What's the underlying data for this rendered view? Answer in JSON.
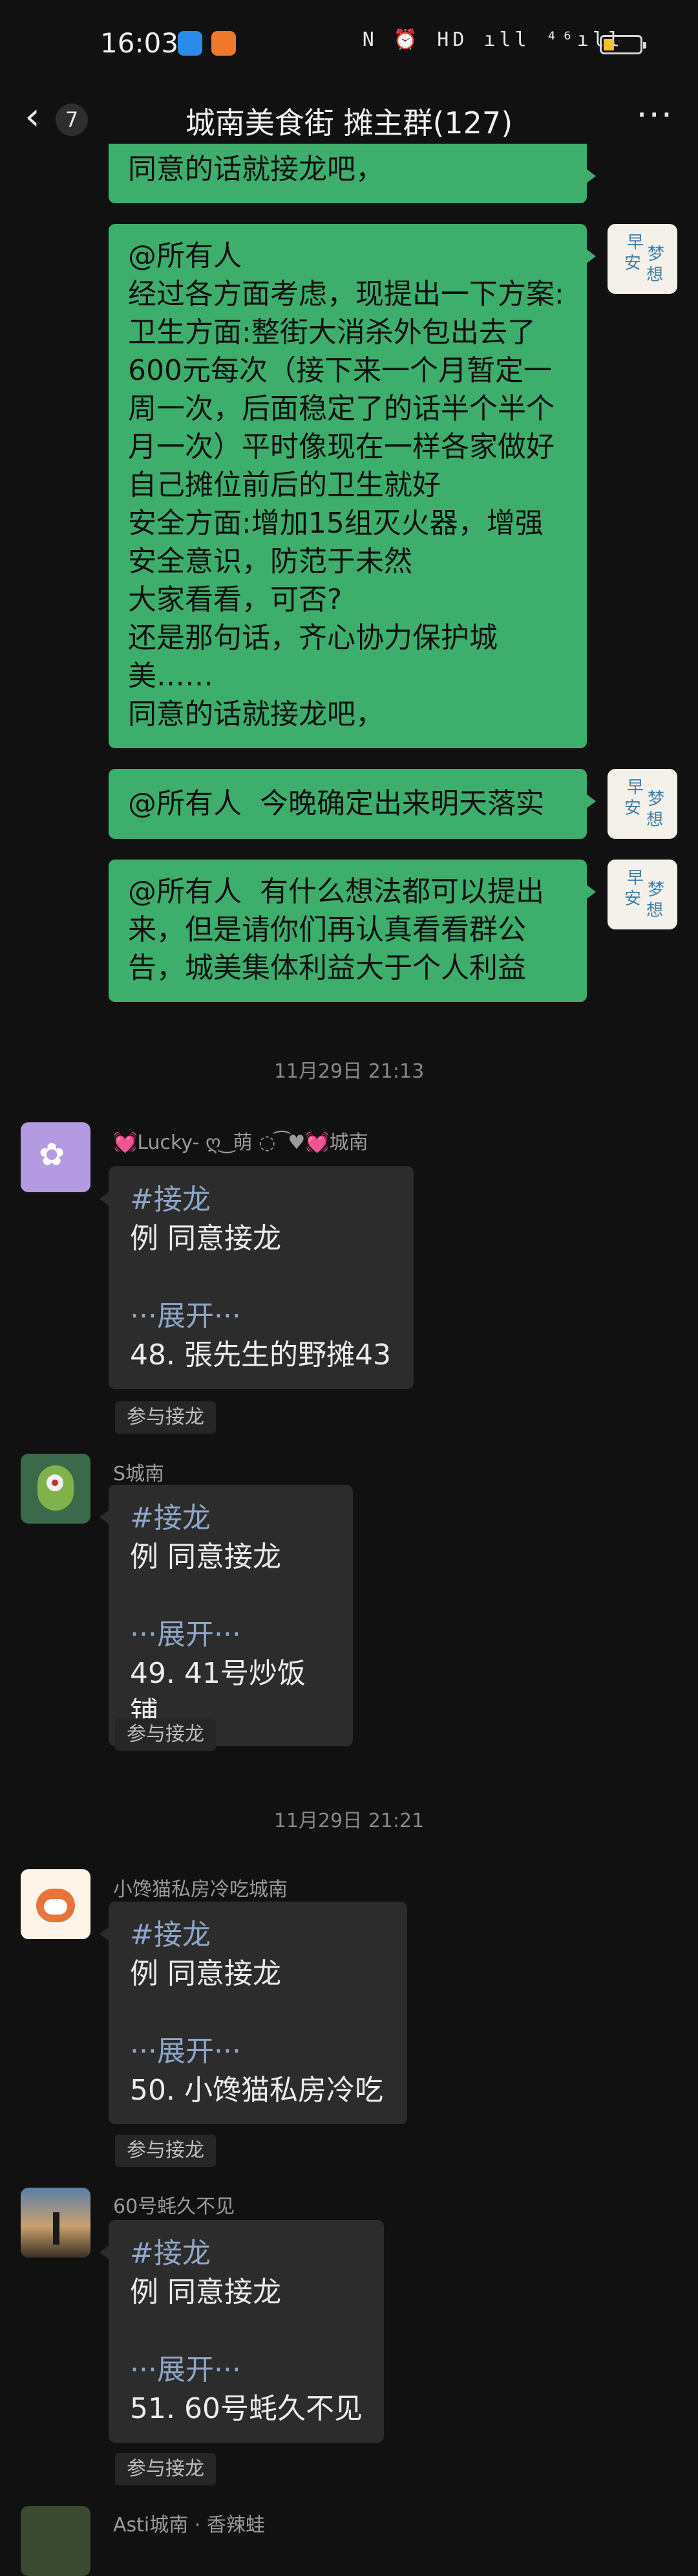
{
  "status_bar": {
    "time": "16:03",
    "right_icons": "N ⏰ HD ıll ⁴⁶ıll"
  },
  "header": {
    "back_count": "7",
    "title": "城南美食街 摊主群(127)"
  },
  "messages_top": [
    {
      "text": "同意的话就接龙吧，",
      "avatar_text": ""
    },
    {
      "text": "@所有人\n经过各方面考虑，现提出一下方案:\n卫生方面:整街大消杀外包出去了\n600元每次（接下来一个月暂定一\n周一次，后面稳定了的话半个半个\n月一次）平时像现在一样各家做好\n自己摊位前后的卫生就好\n安全方面:增加15组灭火器，增强\n安全意识，防范于未然\n大家看看，可否?\n还是那句话，齐心协力保护城\n美……\n同意的话就接龙吧，",
      "avatar_text": "早安梦想"
    },
    {
      "text": "@所有人  今晚确定出来明天落实",
      "avatar_text": "早安梦想"
    },
    {
      "text": "@所有人  有什么想法都可以提出\n来，但是请你们再认真看看群公\n告，城美集体利益大于个人利益",
      "avatar_text": "早安梦想"
    }
  ],
  "avatar_me": {
    "chars": [
      "早",
      "安",
      "梦",
      "想"
    ]
  },
  "timestamps": [
    "11月29日 21:13",
    "11月29日 21:21"
  ],
  "chain_messages": [
    {
      "sender": "💓Lucky- ღ ͜ 萌 ◌ ͡ ♥💓城南",
      "tag": "#接龙",
      "example": "例 同意接龙",
      "expand": "···展开···",
      "entry": "48. 張先生的野摊43",
      "join": "参与接龙"
    },
    {
      "sender": "S城南",
      "tag": "#接龙",
      "example": "例 同意接龙",
      "expand": "···展开···",
      "entry": "49. 41号炒饭铺",
      "join": "参与接龙"
    },
    {
      "sender": "小馋猫私房冷吃城南",
      "tag": "#接龙",
      "example": "例 同意接龙",
      "expand": "···展开···",
      "entry": "50. 小馋猫私房冷吃",
      "join": "参与接龙"
    },
    {
      "sender": "60号蚝久不见",
      "tag": "#接龙",
      "example": "例 同意接龙",
      "expand": "···展开···",
      "entry": "51. 60号蚝久不见",
      "join": "参与接龙"
    }
  ],
  "bottom_partial_sender": "Asti城南 · 香辣蛙",
  "colors": {
    "me_bubble": "#3dae6c",
    "other_bubble": "#2c2c2c",
    "background": "#111111",
    "link": "#8fa6c8"
  }
}
